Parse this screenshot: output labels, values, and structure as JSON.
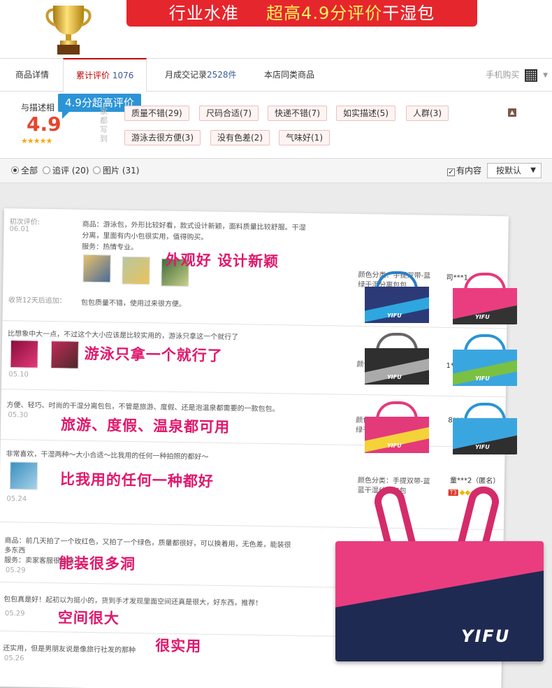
{
  "banner": {
    "title_prefix": "行业水准",
    "title_accent": "超高4.9分评价",
    "title_suffix": "干湿包"
  },
  "tabs": [
    {
      "label": "商品详情",
      "count": ""
    },
    {
      "label": "累计评价",
      "count": "1076"
    },
    {
      "label": "月成交记录",
      "count": "2528件"
    },
    {
      "label": "本店同类商品",
      "count": ""
    }
  ],
  "phone_buy": {
    "label": "手机购买"
  },
  "rating": {
    "label": "与描述相",
    "score": "4.9",
    "stars": "★★★★★",
    "callout": "4.9分超高评价",
    "vertical_text": "家都写到"
  },
  "tags": [
    {
      "label": "质量不错(29)"
    },
    {
      "label": "尺码合适(7)"
    },
    {
      "label": "快递不错(7)"
    },
    {
      "label": "如实描述(5)"
    },
    {
      "label": "人群(3)"
    },
    {
      "label": "游泳去很方便(3)"
    },
    {
      "label": "没有色差(2)"
    },
    {
      "label": "气味好(1)"
    }
  ],
  "filter": {
    "options": [
      {
        "label": "全部",
        "selected": true
      },
      {
        "label": "追评 (20)",
        "selected": false
      },
      {
        "label": "图片 (31)",
        "selected": false
      }
    ],
    "has_content_label": "有内容",
    "has_content_checked": true,
    "sort_label": "按默认"
  },
  "reviews": [
    {
      "label": "初次评价:",
      "date": "06.01",
      "line1": "商品：游泳包，外形比较好看，款式设计新颖，面料质量比较舒服。干湿",
      "line2": "分离，里面有内小包很实用，值得购买。",
      "line3": "服务：热情专业。",
      "caption": "外观好 设计新颖",
      "append_label": "收货12天后追加：",
      "append_text": "包包质量不错，使用过来很方便。",
      "sku": "颜色分类：手提双带-蓝",
      "sku2": "绿干湿分离包包",
      "buyer": "司***1"
    },
    {
      "text": "比想象中大一点，不过这个大小应该是比较实用的，游泳只拿这一个就行了",
      "caption": "游泳只拿一个就行了",
      "date": "05.10",
      "sku": "颜色分",
      "sku2": "带-",
      "buyer": "1***"
    },
    {
      "text": "方便、轻巧、时尚的干湿分离包包，不管是旅游、度假、还是泡温泉都需要的一款包包。",
      "caption": "旅游、度假、温泉都可用",
      "date": "05.30",
      "sku": "颜色分类：手提双带-蓝",
      "sku2": "绿干湿分离包包",
      "buyer": "8***"
    },
    {
      "text": "非常喜欢，干湿两种～大小合适～比我用的任何一种拍照的都好～",
      "caption": "比我用的任何一种都好",
      "date": "05.24",
      "sku": "颜色分类：手提双带-蓝",
      "sku2": "蓝干湿分离包包",
      "buyer": "童***2（匿名）",
      "level": "T3"
    },
    {
      "text": "商品：前几天拍了一个玫红色，又拍了一个绿色，质量都很好，可以换着用，无色差，能装很",
      "text2": "多东西",
      "text3": "服务：卖家客服很热情",
      "caption": "能装很多洞",
      "date": "05.29"
    },
    {
      "text": "包包真是好！起初以为挺小的，货到手才发现里面空间还真是很大，好东西，推荐！",
      "caption": "空间很大",
      "date": "05.29"
    },
    {
      "text": "还实用，但是男朋友说是像旅行社发的那种",
      "caption": "很实用",
      "date": "05.26"
    }
  ],
  "product_brand": "YIFU",
  "colors": {
    "accent_red": "#e6262d",
    "callout_blue": "#2b94d6",
    "caption_pink": "#e0186c",
    "bag_pink": "#ea3d7f",
    "bag_navy": "#1f2a52"
  }
}
